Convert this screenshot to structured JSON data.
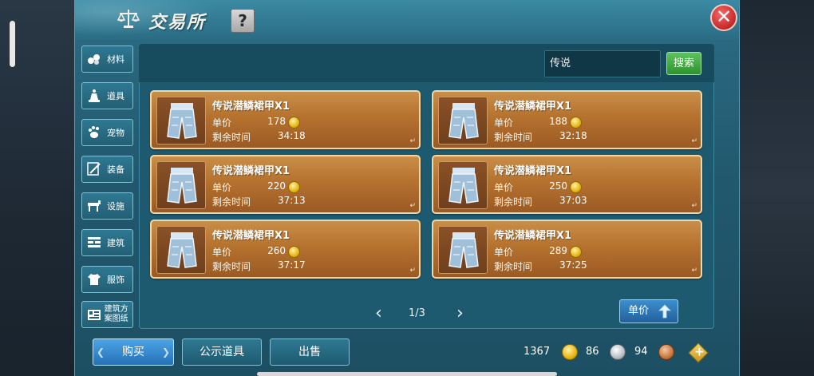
{
  "window": {
    "title": "交易所",
    "help_label": "?",
    "close_label": "✕"
  },
  "categories": [
    {
      "label": "材料",
      "icon": "ore-icon"
    },
    {
      "label": "道具",
      "icon": "bell-icon"
    },
    {
      "label": "宠物",
      "icon": "paw-icon"
    },
    {
      "label": "装备",
      "icon": "sword-icon"
    },
    {
      "label": "设施",
      "icon": "horse-icon"
    },
    {
      "label": "建筑",
      "icon": "wall-icon"
    },
    {
      "label": "服饰",
      "icon": "shirt-icon"
    },
    {
      "label": "建筑方案图纸",
      "icon": "blueprint-icon"
    }
  ],
  "search": {
    "value": "传说",
    "button_label": "搜索"
  },
  "listings": {
    "price_label": "单价",
    "time_label": "剩余时间",
    "items": [
      {
        "name": "传说潜鳞裙甲X1",
        "price": "178",
        "time": "34:18"
      },
      {
        "name": "传说潜鳞裙甲X1",
        "price": "188",
        "time": "32:18"
      },
      {
        "name": "传说潜鳞裙甲X1",
        "price": "220",
        "time": "37:13"
      },
      {
        "name": "传说潜鳞裙甲X1",
        "price": "250",
        "time": "37:03"
      },
      {
        "name": "传说潜鳞裙甲X1",
        "price": "260",
        "time": "37:17"
      },
      {
        "name": "传说潜鳞裙甲X1",
        "price": "289",
        "time": "37:25"
      }
    ]
  },
  "pager": {
    "text": "1/3",
    "prev_label": "‹",
    "next_label": "›"
  },
  "sort": {
    "label": "单价"
  },
  "bottom": {
    "buy_label": "购买",
    "public_label": "公示道具",
    "sell_label": "出售"
  },
  "wallet": {
    "gold": "1367",
    "silver": "86",
    "copper": "94"
  },
  "colors": {
    "accent_green": "#2e922e",
    "card_orange": "#b5722f",
    "panel_teal": "#1d5a70",
    "close_red": "#c62828"
  }
}
